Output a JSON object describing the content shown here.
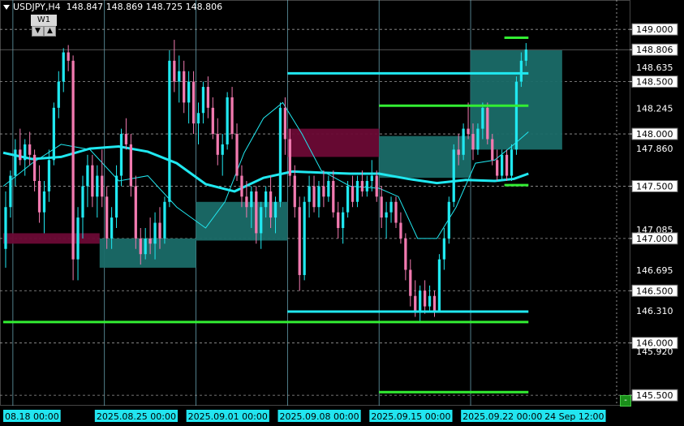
{
  "header": {
    "symbol": "USDJPY,H4",
    "open": "148.847",
    "high": "148.869",
    "low": "148.725",
    "close": "148.806"
  },
  "timeframe_widget": {
    "label": "W1",
    "down": "▼",
    "up": "▲"
  },
  "corner_button": "-",
  "colors": {
    "bull": "#20e8f0",
    "bear": "#f27ab0",
    "green_line": "#33ee33",
    "zone_teal": "#1a6b68",
    "zone_maroon": "#6b0a35",
    "price_label_bg": "#ffffff"
  },
  "chart_data": {
    "type": "candlestick",
    "symbol": "USDJPY",
    "timeframe": "H4",
    "ylim": [
      145.4,
      149.25
    ],
    "xlim": [
      0,
      130
    ],
    "price_labels": [
      {
        "price": 149.0,
        "text": "149.000",
        "boxed": true
      },
      {
        "price": 148.806,
        "text": "148.806",
        "boxed": true
      },
      {
        "price": 148.635,
        "text": "148.635",
        "boxed": false
      },
      {
        "price": 148.5,
        "text": "148.500",
        "boxed": true
      },
      {
        "price": 148.245,
        "text": "148.245",
        "boxed": false
      },
      {
        "price": 148.0,
        "text": "148.000",
        "boxed": true
      },
      {
        "price": 147.86,
        "text": "147.860",
        "boxed": false
      },
      {
        "price": 147.5,
        "text": "147.500",
        "boxed": true
      },
      {
        "price": 147.085,
        "text": "147.085",
        "boxed": false
      },
      {
        "price": 147.0,
        "text": "147.000",
        "boxed": true
      },
      {
        "price": 146.695,
        "text": "146.695",
        "boxed": false
      },
      {
        "price": 146.5,
        "text": "146.500",
        "boxed": true
      },
      {
        "price": 146.31,
        "text": "146.310",
        "boxed": false
      },
      {
        "price": 146.0,
        "text": "146.000",
        "boxed": true
      },
      {
        "price": 145.92,
        "text": "145.920",
        "boxed": false
      },
      {
        "price": 145.5,
        "text": "145.500",
        "boxed": true
      }
    ],
    "time_labels": [
      {
        "bar": 0,
        "text": "08.18 00:00"
      },
      {
        "bar": 19,
        "text": "2025.08.25 00:00"
      },
      {
        "bar": 38,
        "text": "2025.09.01 00:00"
      },
      {
        "bar": 57,
        "text": "2025.09.08 00:00"
      },
      {
        "bar": 76,
        "text": "2025.09.15 00:00"
      },
      {
        "bar": 95,
        "text": "2025.09.22 00:00"
      },
      {
        "bar": 112,
        "text": "24 Sep 12:00"
      }
    ],
    "week_separators": [
      2,
      21,
      40,
      59,
      78,
      97
    ],
    "dashed_levels": [
      149.0,
      148.5,
      148.0,
      147.5,
      147.0,
      146.5,
      146.0,
      145.5
    ],
    "zones": [
      {
        "color": "maroon",
        "x0": 0,
        "x1": 20,
        "y_low": 146.95,
        "y_high": 147.05
      },
      {
        "color": "teal",
        "x0": 20,
        "x1": 40,
        "y_low": 146.72,
        "y_high": 147.0
      },
      {
        "color": "teal",
        "x0": 40,
        "x1": 59,
        "y_low": 146.98,
        "y_high": 147.35
      },
      {
        "color": "maroon",
        "x0": 59,
        "x1": 78,
        "y_low": 147.78,
        "y_high": 148.05
      },
      {
        "color": "teal",
        "x0": 78,
        "x1": 97,
        "y_low": 147.58,
        "y_high": 147.98
      },
      {
        "color": "teal",
        "x0": 97,
        "x1": 116,
        "y_low": 147.85,
        "y_high": 148.8
      }
    ],
    "levels": [
      {
        "color": "cyan",
        "x0": 59,
        "x1": 109,
        "price": 148.58
      },
      {
        "color": "cyan",
        "x0": 59,
        "x1": 109,
        "price": 146.3
      },
      {
        "color": "green",
        "x0": 78,
        "x1": 109,
        "price": 148.27
      },
      {
        "color": "green",
        "x0": 0,
        "x1": 109,
        "price": 146.2
      },
      {
        "color": "green",
        "x0": 78,
        "x1": 109,
        "price": 145.53
      },
      {
        "color": "green",
        "x0": 104,
        "x1": 109,
        "price": 148.92
      },
      {
        "color": "green",
        "x0": 104,
        "x1": 109,
        "price": 147.51
      }
    ],
    "ma_slow": [
      [
        0,
        147.82
      ],
      [
        6,
        147.76
      ],
      [
        12,
        147.78
      ],
      [
        18,
        147.86
      ],
      [
        24,
        147.88
      ],
      [
        30,
        147.83
      ],
      [
        36,
        147.72
      ],
      [
        42,
        147.52
      ],
      [
        48,
        147.45
      ],
      [
        54,
        147.58
      ],
      [
        60,
        147.64
      ],
      [
        66,
        147.63
      ],
      [
        72,
        147.62
      ],
      [
        78,
        147.62
      ],
      [
        84,
        147.57
      ],
      [
        90,
        147.53
      ],
      [
        96,
        147.56
      ],
      [
        102,
        147.55
      ],
      [
        106,
        147.57
      ],
      [
        109,
        147.62
      ]
    ],
    "ma_fast": [
      [
        0,
        147.5
      ],
      [
        6,
        147.72
      ],
      [
        12,
        147.9
      ],
      [
        18,
        147.85
      ],
      [
        24,
        147.55
      ],
      [
        30,
        147.6
      ],
      [
        36,
        147.3
      ],
      [
        42,
        147.1
      ],
      [
        46,
        147.35
      ],
      [
        50,
        147.82
      ],
      [
        54,
        148.15
      ],
      [
        58,
        148.3
      ],
      [
        62,
        148.0
      ],
      [
        66,
        147.65
      ],
      [
        72,
        147.5
      ],
      [
        78,
        147.48
      ],
      [
        82,
        147.4
      ],
      [
        86,
        147.0
      ],
      [
        90,
        147.0
      ],
      [
        94,
        147.3
      ],
      [
        98,
        147.72
      ],
      [
        102,
        147.75
      ],
      [
        106,
        147.9
      ],
      [
        109,
        148.02
      ]
    ],
    "candles": [
      [
        146.9,
        147.45,
        146.72,
        147.3
      ],
      [
        147.3,
        147.65,
        147.2,
        147.6
      ],
      [
        147.6,
        147.95,
        147.5,
        147.85
      ],
      [
        147.85,
        148.05,
        147.7,
        147.75
      ],
      [
        147.75,
        147.95,
        147.6,
        147.9
      ],
      [
        147.9,
        148.02,
        147.7,
        147.8
      ],
      [
        147.8,
        147.85,
        147.45,
        147.55
      ],
      [
        147.55,
        147.7,
        147.15,
        147.25
      ],
      [
        147.25,
        147.55,
        147.05,
        147.45
      ],
      [
        147.45,
        147.85,
        147.35,
        147.75
      ],
      [
        147.75,
        148.3,
        147.7,
        148.25
      ],
      [
        148.25,
        148.6,
        148.15,
        148.5
      ],
      [
        148.5,
        148.82,
        148.4,
        148.78
      ],
      [
        148.78,
        148.85,
        148.6,
        148.7
      ],
      [
        148.7,
        148.75,
        146.6,
        146.8
      ],
      [
        146.8,
        147.3,
        146.6,
        147.2
      ],
      [
        147.2,
        147.6,
        147.0,
        147.5
      ],
      [
        147.5,
        147.8,
        147.3,
        147.7
      ],
      [
        147.7,
        147.8,
        147.3,
        147.4
      ],
      [
        147.4,
        147.7,
        147.2,
        147.6
      ],
      [
        147.6,
        147.85,
        147.3,
        147.4
      ],
      [
        147.4,
        147.5,
        146.9,
        147.0
      ],
      [
        147.0,
        147.3,
        146.9,
        147.2
      ],
      [
        147.2,
        147.7,
        147.1,
        147.6
      ],
      [
        147.6,
        148.05,
        147.5,
        148.0
      ],
      [
        148.0,
        148.15,
        147.85,
        147.9
      ],
      [
        147.9,
        148.0,
        147.4,
        147.5
      ],
      [
        147.5,
        147.6,
        146.9,
        147.0
      ],
      [
        147.0,
        147.1,
        146.75,
        146.85
      ],
      [
        146.85,
        147.1,
        146.8,
        147.0
      ],
      [
        147.0,
        147.2,
        146.85,
        146.95
      ],
      [
        146.95,
        147.25,
        146.8,
        147.15
      ],
      [
        147.15,
        147.3,
        146.9,
        147.0
      ],
      [
        147.0,
        147.4,
        146.95,
        147.35
      ],
      [
        147.35,
        148.8,
        147.3,
        148.7
      ],
      [
        148.7,
        148.9,
        148.4,
        148.5
      ],
      [
        148.5,
        148.75,
        148.3,
        148.6
      ],
      [
        148.6,
        148.7,
        148.2,
        148.3
      ],
      [
        148.3,
        148.6,
        148.1,
        148.5
      ],
      [
        148.5,
        148.6,
        148.0,
        148.1
      ],
      [
        148.1,
        148.3,
        147.9,
        148.2
      ],
      [
        148.2,
        148.5,
        148.1,
        148.45
      ],
      [
        148.45,
        148.55,
        148.15,
        148.25
      ],
      [
        148.25,
        148.35,
        147.95,
        148.0
      ],
      [
        148.0,
        148.15,
        147.7,
        147.8
      ],
      [
        147.8,
        148.0,
        147.6,
        147.9
      ],
      [
        147.9,
        148.4,
        147.85,
        148.35
      ],
      [
        148.35,
        148.45,
        147.95,
        148.0
      ],
      [
        148.0,
        148.1,
        147.55,
        147.6
      ],
      [
        147.6,
        147.7,
        147.3,
        147.4
      ],
      [
        147.4,
        147.55,
        147.2,
        147.3
      ],
      [
        147.3,
        147.5,
        147.1,
        147.45
      ],
      [
        147.45,
        147.5,
        146.95,
        147.05
      ],
      [
        147.05,
        147.35,
        146.9,
        147.3
      ],
      [
        147.3,
        147.5,
        147.2,
        147.45
      ],
      [
        147.45,
        147.6,
        147.1,
        147.2
      ],
      [
        147.2,
        147.4,
        147.05,
        147.35
      ],
      [
        147.35,
        148.3,
        147.3,
        148.25
      ],
      [
        148.25,
        148.35,
        147.8,
        147.95
      ],
      [
        147.95,
        148.05,
        147.5,
        147.6
      ],
      [
        147.6,
        147.7,
        147.2,
        147.3
      ],
      [
        147.3,
        147.4,
        146.5,
        146.65
      ],
      [
        146.65,
        147.4,
        146.6,
        147.35
      ],
      [
        147.35,
        147.6,
        147.2,
        147.5
      ],
      [
        147.5,
        147.6,
        147.25,
        147.3
      ],
      [
        147.3,
        147.55,
        147.2,
        147.5
      ],
      [
        147.5,
        147.65,
        147.3,
        147.4
      ],
      [
        147.4,
        147.6,
        147.35,
        147.55
      ],
      [
        147.55,
        147.65,
        147.2,
        147.25
      ],
      [
        147.25,
        147.35,
        147.0,
        147.1
      ],
      [
        147.1,
        147.3,
        146.95,
        147.25
      ],
      [
        147.25,
        147.55,
        147.2,
        147.5
      ],
      [
        147.5,
        147.6,
        147.3,
        147.35
      ],
      [
        147.35,
        147.6,
        147.3,
        147.55
      ],
      [
        147.55,
        147.65,
        147.4,
        147.45
      ],
      [
        147.45,
        147.6,
        147.4,
        147.55
      ],
      [
        147.55,
        147.75,
        147.45,
        147.6
      ],
      [
        147.6,
        147.65,
        147.35,
        147.4
      ],
      [
        147.4,
        147.5,
        147.1,
        147.2
      ],
      [
        147.2,
        147.35,
        147.0,
        147.25
      ],
      [
        147.25,
        147.4,
        147.15,
        147.35
      ],
      [
        147.35,
        147.4,
        147.1,
        147.15
      ],
      [
        147.15,
        147.25,
        146.95,
        147.0
      ],
      [
        147.0,
        147.05,
        146.6,
        146.7
      ],
      [
        146.7,
        146.8,
        146.35,
        146.45
      ],
      [
        146.45,
        146.6,
        146.25,
        146.3
      ],
      [
        146.3,
        146.55,
        146.2,
        146.5
      ],
      [
        146.5,
        146.6,
        146.28,
        146.35
      ],
      [
        146.35,
        146.55,
        146.3,
        146.45
      ],
      [
        146.45,
        146.5,
        146.25,
        146.3
      ],
      [
        146.3,
        146.85,
        146.3,
        146.8
      ],
      [
        146.8,
        147.1,
        146.7,
        147.0
      ],
      [
        147.0,
        147.4,
        146.95,
        147.35
      ],
      [
        147.35,
        147.9,
        147.3,
        147.85
      ],
      [
        147.85,
        148.0,
        147.7,
        147.8
      ],
      [
        147.8,
        148.1,
        147.75,
        148.05
      ],
      [
        148.05,
        148.3,
        147.95,
        148.0
      ],
      [
        148.0,
        148.1,
        147.75,
        147.85
      ],
      [
        147.85,
        148.1,
        147.8,
        148.05
      ],
      [
        148.05,
        148.3,
        147.95,
        148.25
      ],
      [
        148.25,
        148.3,
        147.9,
        147.95
      ],
      [
        147.95,
        148.0,
        147.7,
        147.75
      ],
      [
        147.75,
        147.85,
        147.55,
        147.6
      ],
      [
        147.6,
        147.85,
        147.55,
        147.8
      ],
      [
        147.8,
        147.85,
        147.55,
        147.6
      ],
      [
        147.6,
        147.9,
        147.55,
        147.85
      ],
      [
        147.85,
        148.55,
        147.8,
        148.5
      ],
      [
        148.5,
        148.78,
        148.45,
        148.7
      ],
      [
        148.7,
        148.869,
        148.65,
        148.806
      ]
    ]
  }
}
